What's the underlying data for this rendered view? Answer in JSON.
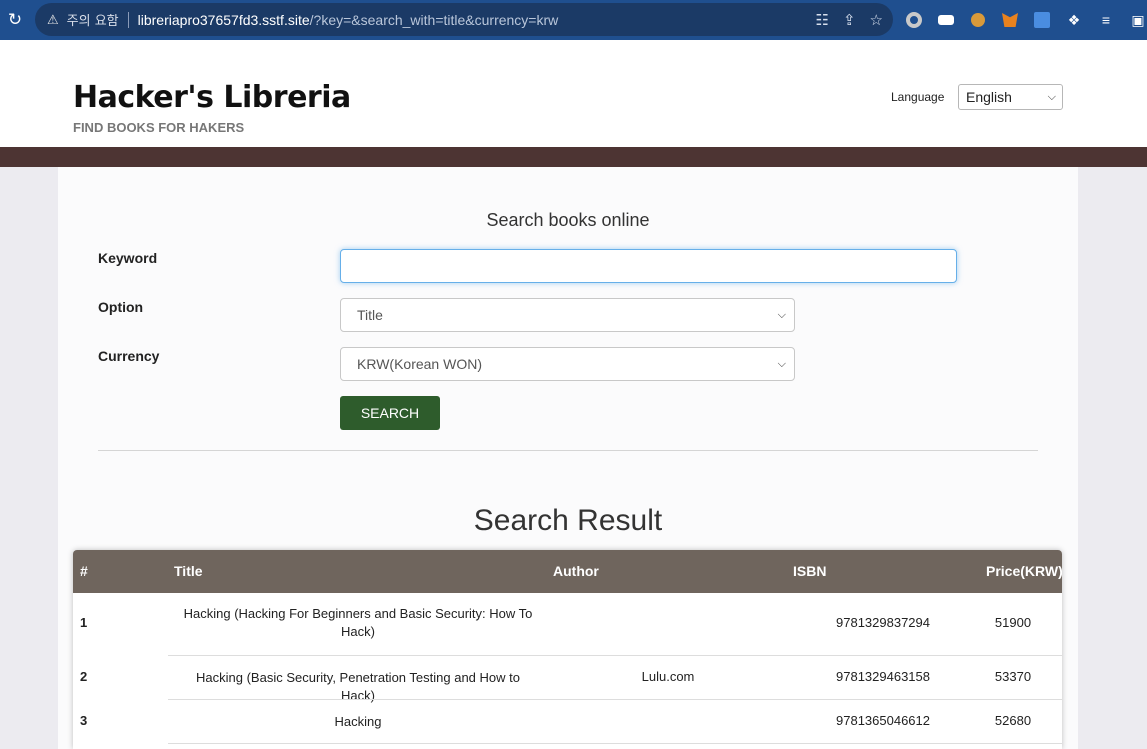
{
  "browser": {
    "warning_label": "주의 요함",
    "url_host": "libreriapro37657fd3.sstf.site",
    "url_rest": "/?key=&search_with=title&currency=krw"
  },
  "header": {
    "title": "Hacker's Libreria",
    "subtitle": "FIND BOOKS FOR HAKERS",
    "language_label": "Language",
    "language_value": "English"
  },
  "search_form": {
    "heading": "Search books online",
    "keyword_label": "Keyword",
    "keyword_value": "",
    "option_label": "Option",
    "option_value": "Title",
    "currency_label": "Currency",
    "currency_value": "KRW(Korean WON)",
    "search_button": "SEARCH"
  },
  "results": {
    "heading": "Search Result",
    "columns": [
      "#",
      "Title",
      "Author",
      "ISBN",
      "Price(KRW)"
    ],
    "rows": [
      {
        "num": "1",
        "title": "Hacking (Hacking For Beginners and Basic Security: How To Hack)",
        "author": "",
        "isbn": "9781329837294",
        "price": "51900"
      },
      {
        "num": "2",
        "title": "Hacking (Basic Security, Penetration Testing and How to Hack)",
        "author": "Lulu.com",
        "isbn": "9781329463158",
        "price": "53370"
      },
      {
        "num": "3",
        "title": "Hacking",
        "author": "",
        "isbn": "9781365046612",
        "price": "52680"
      }
    ]
  },
  "colors": {
    "chrome_bar": "#1f4f8f",
    "brown_bar": "#4d3433",
    "table_header": "#6f655d",
    "search_button": "#2e5c2c"
  }
}
